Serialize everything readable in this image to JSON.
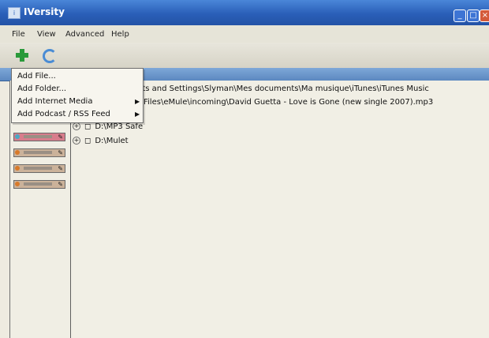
{
  "window": {
    "title": "IVersity"
  },
  "menu": [
    "File",
    "View",
    "Advanced",
    "Help"
  ],
  "dropdown": {
    "items": [
      {
        "label": "Add File..."
      },
      {
        "label": "Add Folder..."
      },
      {
        "label": "Add Internet Media",
        "submenu": true
      },
      {
        "label": "Add Podcast / RSS Feed",
        "submenu": true
      }
    ]
  },
  "paths": {
    "line1": "nts and Settings\\Slyman\\Mes documents\\Ma musique\\iTunes\\iTunes Music",
    "line2": "Files\\eMule\\incoming\\David Guetta - Love is Gone (new single 2007).mp3"
  },
  "tree": [
    {
      "label": "D:\\MP3 Safe"
    },
    {
      "label": "D:\\Mulet"
    }
  ],
  "colors": {
    "titlebar": "#2a5fb8",
    "menu_bg": "#e6e4d8",
    "window_bg": "#eeebe0"
  },
  "icons": [
    "add-icon",
    "refresh-icon",
    "expand-icon",
    "drive-icon",
    "submenu-arrow-icon",
    "edit-icon"
  ]
}
